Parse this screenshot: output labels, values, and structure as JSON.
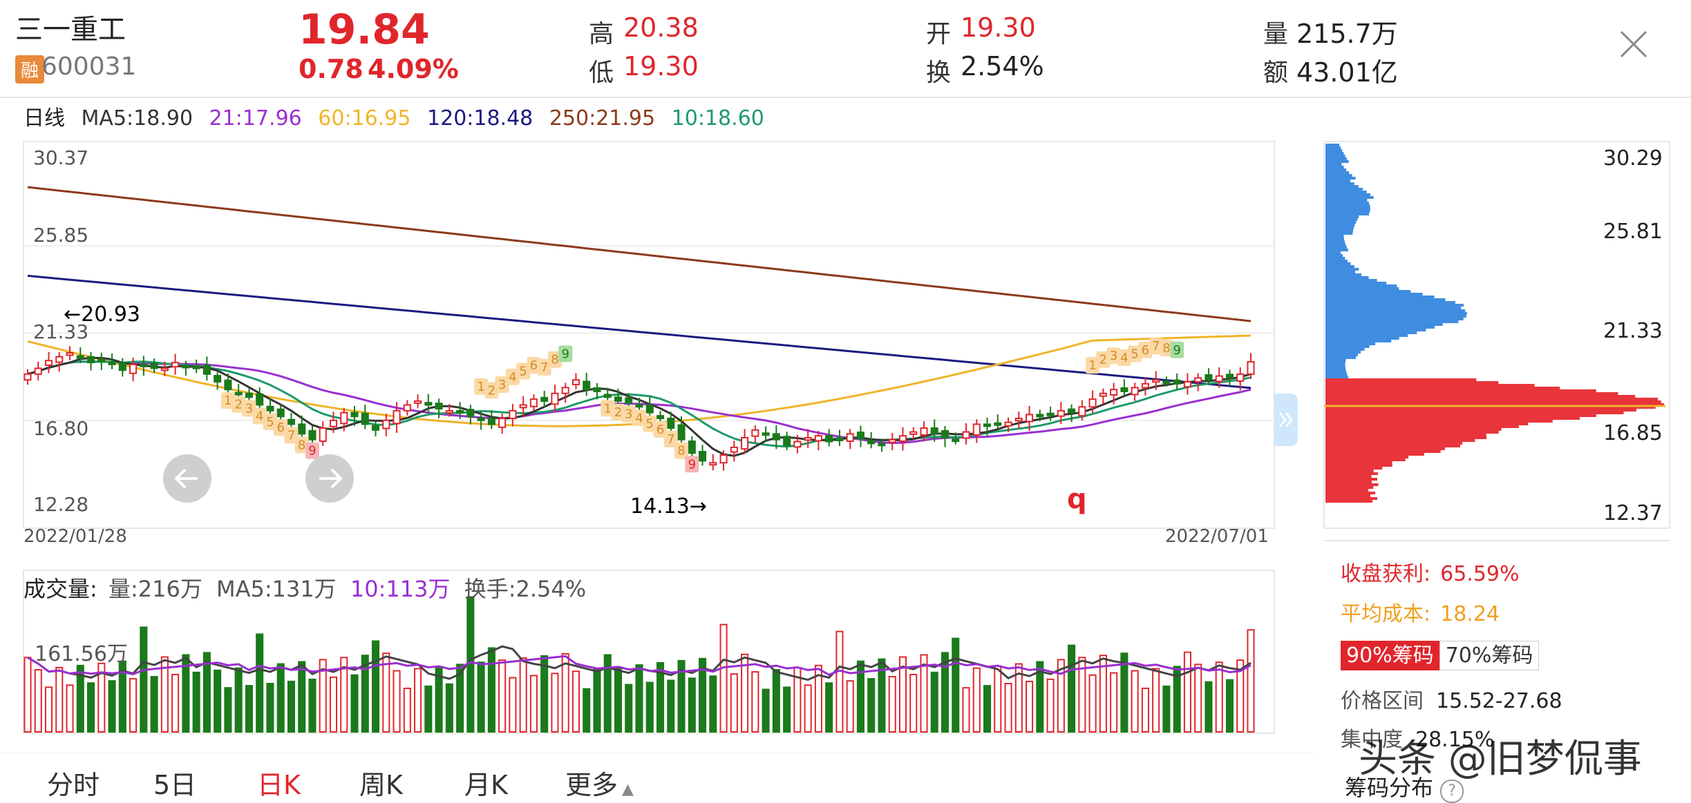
{
  "header": {
    "name": "三一重工",
    "margin_badge": "融",
    "code": "600031",
    "price": "19.84",
    "change": "0.78",
    "change_pct": "4.09%",
    "high_label": "高",
    "high": "20.38",
    "low_label": "低",
    "low": "19.30",
    "open_label": "开",
    "open": "19.30",
    "turnover_label": "换",
    "turnover": "2.54%",
    "volume_label": "量",
    "volume": "215.7万",
    "amount_label": "额",
    "amount": "43.01亿"
  },
  "ma_bar": {
    "period": "日线",
    "ma5": "MA5:18.90",
    "ma21": "21:17.96",
    "ma60": "60:16.95",
    "ma120": "120:18.48",
    "ma250": "250:21.95",
    "ma10": "10:18.60"
  },
  "colors": {
    "up": "#e0262c",
    "down": "#1b7a1b",
    "ma5": "#333333",
    "ma21": "#9b2ed0",
    "ma60": "#f0b429",
    "ma120": "#1a1a80",
    "ma250": "#8b3a1a",
    "ma10": "#1f9a6a",
    "chip_profit": "#e8343a",
    "chip_loss": "#3f8de0"
  },
  "price_axis": {
    "ticks": [
      "30.37",
      "25.85",
      "21.33",
      "16.80",
      "12.28"
    ]
  },
  "date_axis": {
    "start": "2022/01/28",
    "end": "2022/07/01"
  },
  "annotations": {
    "high_mark": "←20.93",
    "low_mark": "14.13→",
    "nine_turn_top_1": [
      "1",
      "2",
      "3",
      "4",
      "5",
      "6",
      "7",
      "8",
      "9"
    ],
    "nine_turn_bottom": [
      "1",
      "2",
      "3",
      "4",
      "5",
      "6",
      "7",
      "8",
      "9"
    ],
    "q_mark": "q"
  },
  "volume_bar": {
    "title": "成交量:",
    "vol": "量:216万",
    "ma5": "MA5:131万",
    "ma10": "10:113万",
    "turnover": "换手:2.54%",
    "axis_tick": "161.56万"
  },
  "chips": {
    "ticks": [
      "30.29",
      "25.81",
      "21.33",
      "16.85",
      "12.37"
    ],
    "profit_label": "收盘获利:",
    "profit": "65.59%",
    "avg_cost_label": "平均成本:",
    "avg_cost": "18.24",
    "btn90": "90%筹码",
    "btn70": "70%筹码",
    "range_label": "价格区间",
    "range": "15.52-27.68",
    "concentration_label": "集中度",
    "concentration": "28.15%",
    "dist_label": "筹码分布"
  },
  "tabs": [
    "分时",
    "5日",
    "日K",
    "周K",
    "月K",
    "更多"
  ],
  "watermark": "头条 @旧梦侃事",
  "chart_data": {
    "type": "candlestick",
    "x_start": "2022/01/28",
    "x_end": "2022/07/01",
    "ylim": [
      12.28,
      30.37
    ],
    "closes": [
      19.2,
      19.5,
      19.9,
      20.1,
      20.3,
      20.1,
      19.8,
      19.9,
      19.7,
      19.4,
      19.7,
      19.6,
      19.5,
      19.5,
      19.8,
      19.6,
      19.5,
      19.2,
      18.8,
      18.4,
      18.2,
      18.0,
      17.6,
      17.3,
      17.0,
      16.6,
      16.1,
      15.8,
      16.4,
      16.8,
      17.2,
      17.0,
      16.6,
      16.3,
      16.8,
      17.3,
      17.6,
      17.8,
      17.6,
      17.4,
      17.3,
      17.2,
      17.0,
      16.8,
      16.6,
      16.9,
      17.3,
      17.6,
      17.9,
      17.8,
      18.2,
      18.5,
      18.9,
      18.4,
      18.3,
      18.0,
      17.8,
      17.7,
      17.5,
      17.2,
      16.9,
      16.4,
      15.8,
      15.1,
      14.7,
      14.6,
      15.0,
      15.4,
      15.9,
      16.3,
      16.1,
      15.8,
      15.5,
      15.7,
      15.9,
      16.0,
      15.7,
      15.8,
      16.1,
      15.9,
      15.6,
      15.5,
      15.8,
      16.0,
      16.2,
      16.4,
      16.1,
      15.9,
      15.8,
      16.2,
      16.6,
      16.5,
      16.6,
      16.7,
      16.9,
      17.1,
      17.0,
      17.1,
      17.3,
      17.2,
      17.5,
      17.9,
      18.2,
      18.4,
      18.3,
      18.5,
      18.7,
      18.9,
      18.8,
      18.7,
      18.8,
      19.0,
      18.9,
      19.1,
      19.0,
      19.2,
      19.84
    ],
    "volume_ylim": [
      0,
      260
    ]
  }
}
